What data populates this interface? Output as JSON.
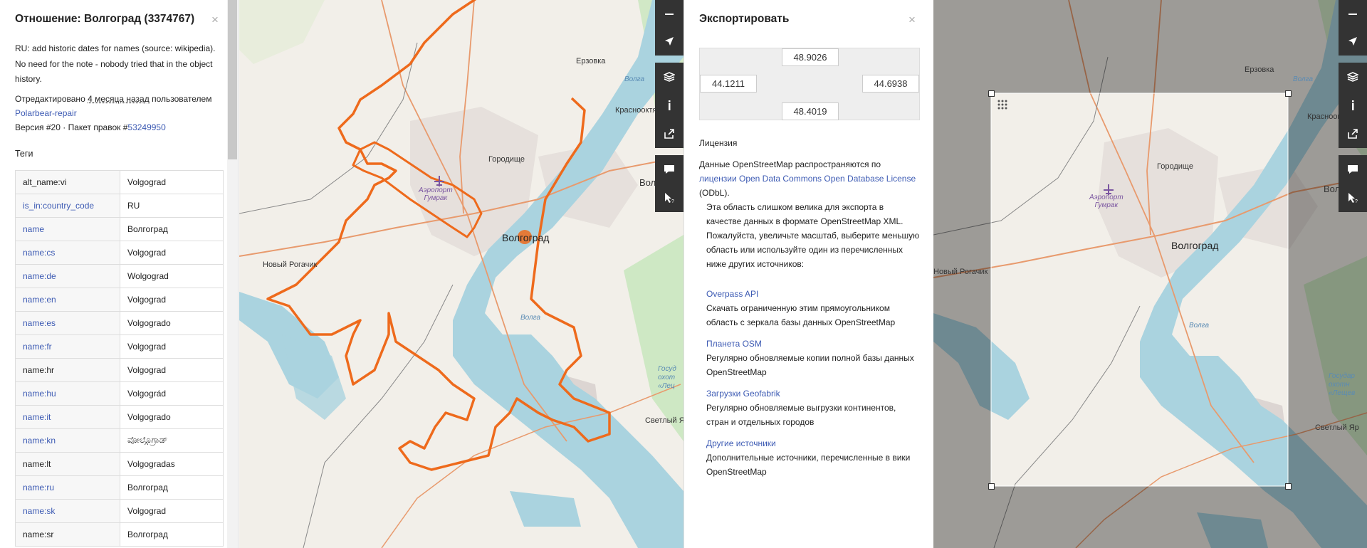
{
  "relation_panel": {
    "title": "Отношение: Волгоград (3374767)",
    "close_glyph": "×",
    "comment": "RU: add historic dates for names (source: wikipedia). No need for the note - nobody tried that in the object history.",
    "edited_prefix": "Отредактировано ",
    "edited_time": "4 месяца назад",
    "edited_by": " пользователем ",
    "user": "Polarbear-repair",
    "version_prefix": "Версия #20 · Пакет правок #",
    "changeset": "53249950",
    "tags_heading": "Теги",
    "tags": [
      {
        "key": "alt_name:vi",
        "value": "Volgograd",
        "key_is_link": false
      },
      {
        "key": "is_in:country_code",
        "value": "RU",
        "key_is_link": true
      },
      {
        "key": "name",
        "value": "Волгоград",
        "key_is_link": true
      },
      {
        "key": "name:cs",
        "value": "Volgograd",
        "key_is_link": true
      },
      {
        "key": "name:de",
        "value": "Wolgograd",
        "key_is_link": true
      },
      {
        "key": "name:en",
        "value": "Volgograd",
        "key_is_link": true
      },
      {
        "key": "name:es",
        "value": "Volgogrado",
        "key_is_link": true
      },
      {
        "key": "name:fr",
        "value": "Volgograd",
        "key_is_link": true
      },
      {
        "key": "name:hr",
        "value": "Volgograd",
        "key_is_link": false
      },
      {
        "key": "name:hu",
        "value": "Volgográd",
        "key_is_link": true
      },
      {
        "key": "name:it",
        "value": "Volgogrado",
        "key_is_link": true
      },
      {
        "key": "name:kn",
        "value": "ವೋಲ್ಗೊಗ್ರಾಡ್",
        "key_is_link": true
      },
      {
        "key": "name:lt",
        "value": "Volgogradas",
        "key_is_link": false
      },
      {
        "key": "name:ru",
        "value": "Волгоград",
        "key_is_link": true
      },
      {
        "key": "name:sk",
        "value": "Volgograd",
        "key_is_link": true
      },
      {
        "key": "name:sr",
        "value": "Волгоград",
        "key_is_link": false
      }
    ]
  },
  "map_left": {
    "labels": {
      "erzovka": "Ерзовка",
      "volga_top": "Волга",
      "krasnooktyabrsky": "Краснооктябрьский",
      "gorodishche": "Городище",
      "airport_line1": "Аэропорт",
      "airport_line2": "Гумрак",
      "volzhsky": "Волжский",
      "volgograd": "Волгоград",
      "novy_rogachik": "Новый Рогачик",
      "volga_mid": "Волга",
      "svetly_yar": "Светлый Яр",
      "gosud_1": "Госуд",
      "gosud_2": "охот",
      "gosud_3": "«Лец"
    }
  },
  "map_right": {
    "labels": {
      "erzovka": "Ерзовка",
      "volga_top": "Волга",
      "krasnooktyabrsky": "Краснооктябрьский",
      "gorodishche": "Городище",
      "airport_line1": "Аэропорт",
      "airport_line2": "Гумрак",
      "volzhsky": "Волжский",
      "volgograd": "Волгоград",
      "novy_rogachik": "Новый Рогачик",
      "volga_mid": "Волга",
      "svetly_yar": "Светлый Яр",
      "gosud_1": "Государ",
      "gosud_2": "охотн",
      "gosud_3": "«Лещев"
    }
  },
  "controls": {
    "items": [
      "zoom-out-icon",
      "locate-icon",
      "layers-icon",
      "info-icon",
      "share-icon",
      "note-icon",
      "query-icon"
    ]
  },
  "export_panel": {
    "title": "Экспортировать",
    "close_glyph": "×",
    "bbox": {
      "north": "48.9026",
      "west": "44.1211",
      "east": "44.6938",
      "south": "48.4019"
    },
    "license_heading": "Лицензия",
    "license_text_1": "Данные OpenStreetMap распространяются по ",
    "license_link": "лицензии Open Data Commons Open Database License",
    "license_text_2": " (ODbL).",
    "warning": "Эта область слишком велика для экспорта в качестве данных в формате OpenStreetMap XML. Пожалуйста, увеличьте масштаб, выберите меньшую область или используйте один из перечисленных ниже других источников:",
    "sources": [
      {
        "name": "Overpass API",
        "desc": "Скачать ограниченную этим прямоугольником область с зеркала базы данных OpenStreetMap"
      },
      {
        "name": "Планета OSM",
        "desc": "Регулярно обновляемые копии полной базы данных OpenStreetMap"
      },
      {
        "name": "Загрузки Geofabrik",
        "desc": "Регулярно обновляемые выгрузки континентов, стран и отдельных городов"
      },
      {
        "name": "Другие источники",
        "desc": "Дополнительные источники, перечисленные в вики OpenStreetMap"
      }
    ]
  },
  "colors": {
    "map_land": "#f2efe9",
    "water": "#aad3df",
    "forest": "#c8e6bd",
    "relation_outline": "#ee6a1c",
    "control_bg": "#333333",
    "link": "#3c5ab3"
  }
}
